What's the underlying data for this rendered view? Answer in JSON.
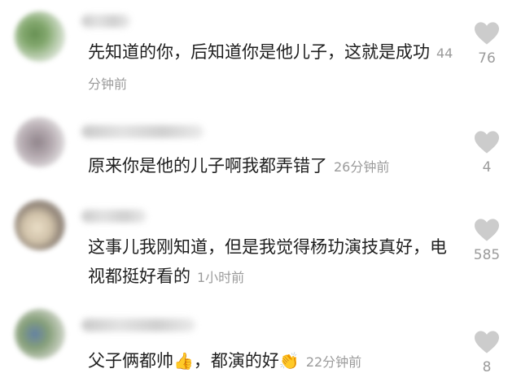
{
  "colors": {
    "text": "#1f1f1f",
    "meta": "#9b9b9b",
    "heart": "#cccccc"
  },
  "comments": [
    {
      "text": "先知道的你，后知道你是他儿子，这就是成功",
      "time": "44分钟前",
      "likes": "76",
      "avatar": "avatar"
    },
    {
      "text": "原来你是他的儿子啊我都弄错了",
      "time": "26分钟前",
      "likes": "4",
      "avatar": "avatar"
    },
    {
      "text": "这事儿我刚知道，但是我觉得杨玏演技真好，电视都挺好看的",
      "time": "1小时前",
      "likes": "585",
      "avatar": "avatar"
    },
    {
      "text_a": "父子俩都帅",
      "emoji_a": "👍",
      "text_b": "，都演的好",
      "emoji_b": "👏",
      "time": "22分钟前",
      "likes": "8",
      "avatar": "avatar"
    }
  ],
  "icons": {
    "like": "heart-icon"
  }
}
